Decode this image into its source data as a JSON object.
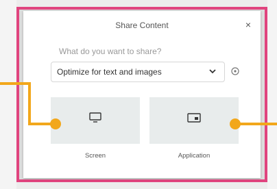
{
  "dialog": {
    "title": "Share Content",
    "close_label": "×",
    "question": "What do you want to share?",
    "dropdown": {
      "selected": "Optimize for text and images",
      "icon": "chevron-down-icon"
    },
    "info_icon": "info-icon",
    "options": [
      {
        "label": "Screen",
        "icon": "monitor-icon"
      },
      {
        "label": "Application",
        "icon": "application-window-icon"
      }
    ]
  },
  "colors": {
    "highlight_border": "#e0447e",
    "callout": "#f2a71b"
  }
}
